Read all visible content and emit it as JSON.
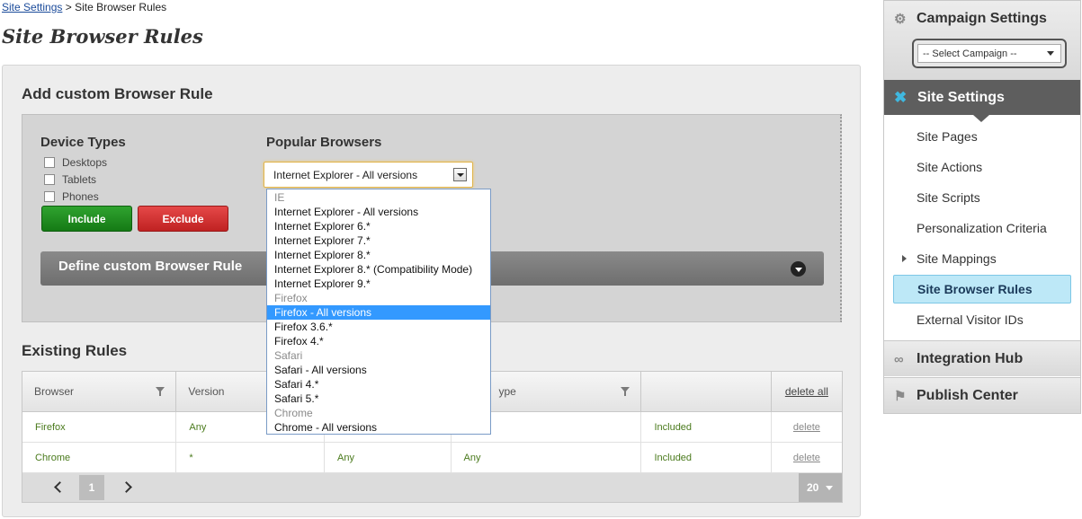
{
  "breadcrumb": {
    "link": "Site Settings",
    "separator": ">",
    "current": "Site Browser Rules"
  },
  "page_title": "Site Browser Rules",
  "add_rule": {
    "title": "Add custom Browser Rule",
    "device_types_label": "Device Types",
    "devices": [
      "Desktops",
      "Tablets",
      "Phones"
    ],
    "include_label": "Include",
    "exclude_label": "Exclude",
    "popular_browsers_label": "Popular Browsers",
    "browser_select_value": "Internet Explorer - All versions",
    "define_custom_label": "Define custom Browser Rule"
  },
  "dropdown": {
    "items": [
      {
        "label": "IE",
        "group": true
      },
      {
        "label": "Internet Explorer - All versions"
      },
      {
        "label": "Internet Explorer 6.*"
      },
      {
        "label": "Internet Explorer 7.*"
      },
      {
        "label": "Internet Explorer 8.*"
      },
      {
        "label": "Internet Explorer 8.* (Compatibility Mode)"
      },
      {
        "label": "Internet Explorer 9.*"
      },
      {
        "label": "Firefox",
        "group": true
      },
      {
        "label": "Firefox - All versions",
        "selected": true
      },
      {
        "label": "Firefox 3.6.*"
      },
      {
        "label": "Firefox 4.*"
      },
      {
        "label": "Safari",
        "group": true
      },
      {
        "label": "Safari - All versions"
      },
      {
        "label": "Safari 4.*"
      },
      {
        "label": "Safari 5.*"
      },
      {
        "label": "Chrome",
        "group": true
      },
      {
        "label": "Chrome - All versions"
      }
    ],
    "selection_color": "#3399ff"
  },
  "existing_rules": {
    "title": "Existing Rules",
    "columns": [
      "Browser",
      "Version",
      "",
      "ype",
      "",
      "delete all"
    ],
    "rows": [
      [
        "Firefox",
        "Any",
        "",
        "",
        "Included",
        "delete"
      ],
      [
        "Chrome",
        "*",
        "Any",
        "Any",
        "Included",
        "delete"
      ]
    ],
    "pager": {
      "page": "1",
      "page_size": "20"
    }
  },
  "sidebar": {
    "campaign_settings": "Campaign Settings",
    "campaign_select": "-- Select Campaign --",
    "site_settings": "Site Settings",
    "items": [
      "Site Pages",
      "Site Actions",
      "Site Scripts",
      "Personalization Criteria",
      "Site Mappings"
    ],
    "active_item": "Site Browser Rules",
    "last_item": "External Visitor IDs",
    "integration_hub": "Integration Hub",
    "publish_center": "Publish Center"
  },
  "colors": {
    "include": "#1a8a1a",
    "exclude": "#d03030",
    "active_bg": "#bde8f7",
    "value_text": "#4a7a1c"
  }
}
